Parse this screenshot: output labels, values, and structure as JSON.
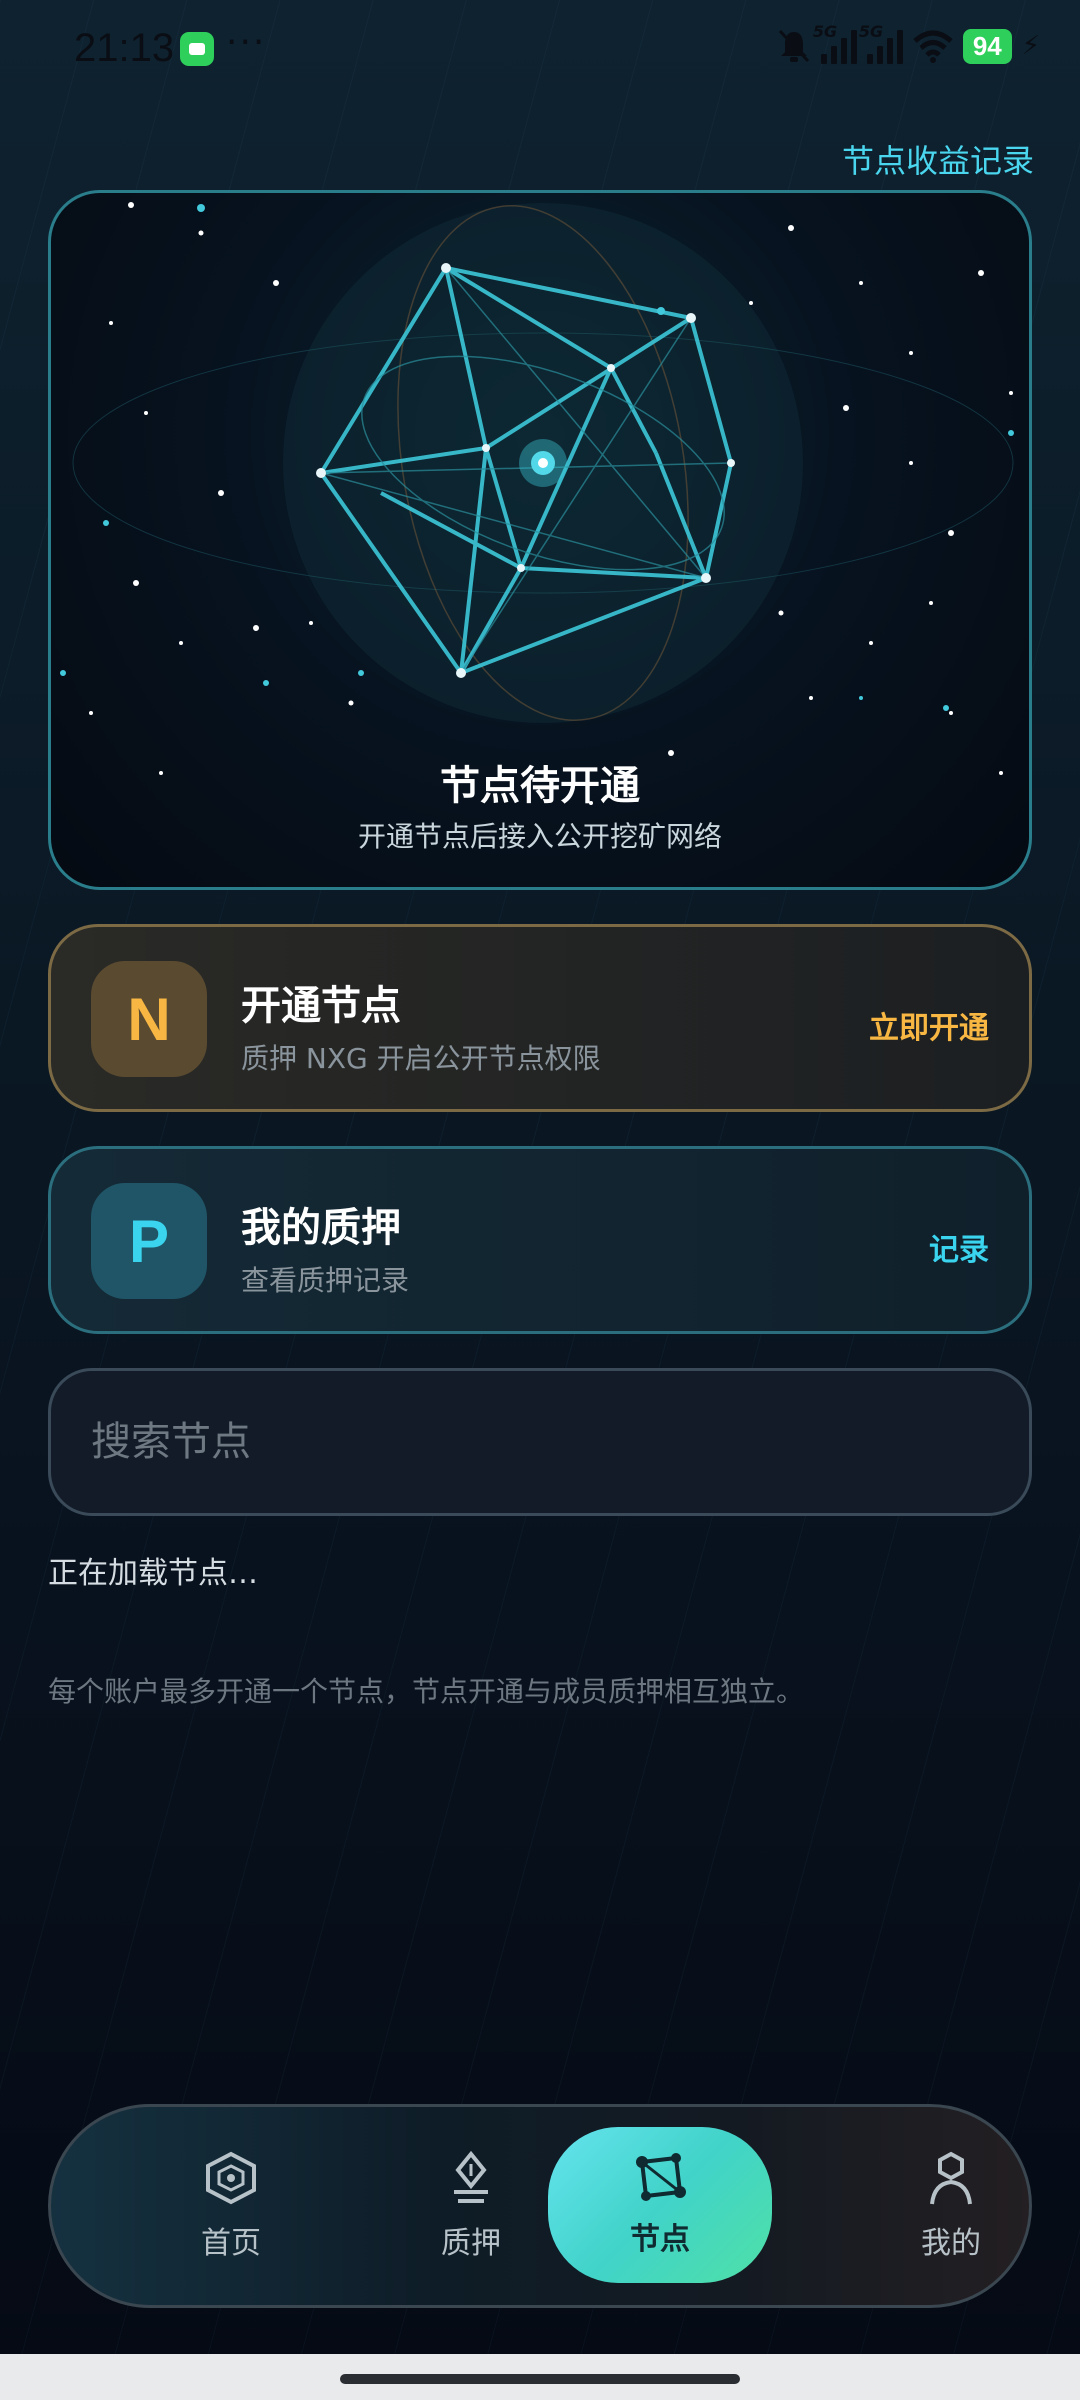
{
  "status_bar": {
    "time": "21:13",
    "network_1": "5G",
    "network_2": "5G",
    "battery": "94"
  },
  "header": {
    "earnings_link": "节点收益记录"
  },
  "hero": {
    "title": "节点待开通",
    "subtitle": "开通节点后接入公开挖矿网络"
  },
  "open_node_card": {
    "icon_letter": "N",
    "title": "开通节点",
    "subtitle": "质押 NXG 开启公开节点权限",
    "action": "立即开通"
  },
  "stake_card": {
    "icon_letter": "P",
    "title": "我的质押",
    "subtitle": "查看质押记录",
    "action": "记录"
  },
  "search": {
    "placeholder": "搜索节点"
  },
  "status": {
    "loading": "正在加载节点…",
    "note": "每个账户最多开通一个节点，节点开通与成员质押相互独立。"
  },
  "nav": {
    "items": [
      {
        "label": "首页",
        "icon": "home-hexagon-icon"
      },
      {
        "label": "质押",
        "icon": "stake-pen-icon"
      },
      {
        "label": "节点",
        "icon": "node-graph-icon",
        "active": true
      },
      {
        "label": "我的",
        "icon": "profile-icon"
      }
    ]
  },
  "colors": {
    "accent_cyan": "#3ad4ee",
    "accent_gold": "#f7b742",
    "nav_active_start": "#65e3ee",
    "nav_active_end": "#4fe0a6"
  }
}
